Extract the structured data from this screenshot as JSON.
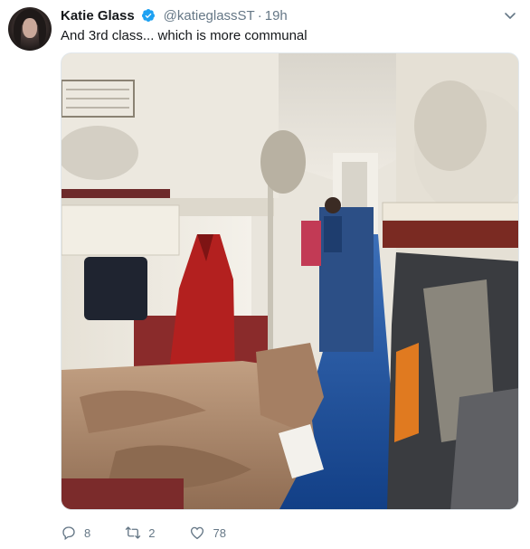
{
  "tweet": {
    "author_name": "Katie Glass",
    "handle": "@katieglassST",
    "separator": "·",
    "time": "19h",
    "text": "And 3rd class... which is more communal",
    "verified": true
  },
  "actions": {
    "replies": "8",
    "retweets": "2",
    "likes": "78"
  },
  "photo": {
    "subject": "third-class sleeper train carriage with bunks, bedding and a woman in the aisle"
  },
  "colors": {
    "text": "#14171a",
    "secondary": "#657786",
    "verified_blue": "#1da1f2",
    "floor_blue": "#1d4f9c",
    "blanket": "#b08a6e",
    "red_jacket": "#b3201f"
  },
  "icons": [
    "verified-badge-icon",
    "chevron-down-icon",
    "reply-icon",
    "retweet-icon",
    "like-icon"
  ]
}
